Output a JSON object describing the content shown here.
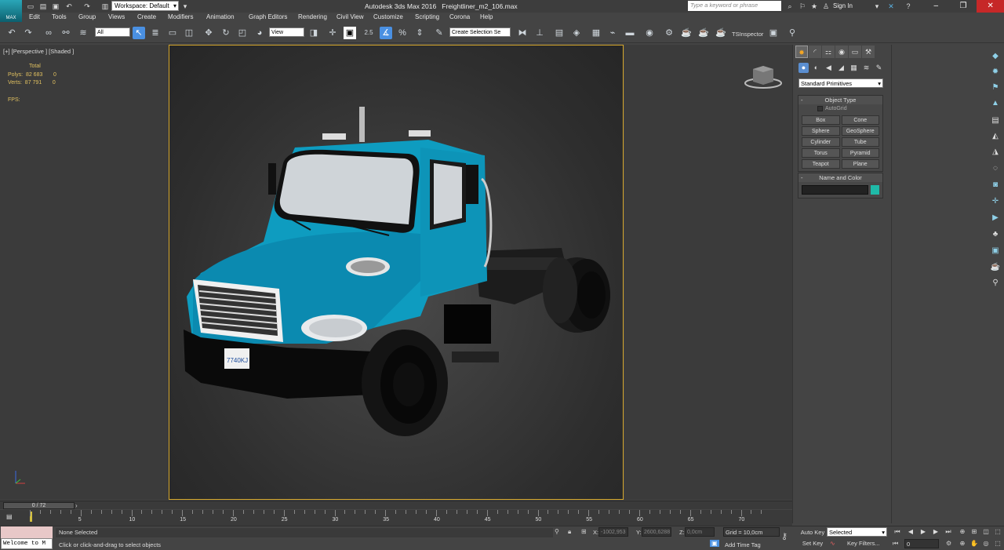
{
  "app": {
    "window_title": "Autodesk 3ds Max 2016",
    "file_name": "Freightliner_m2_106.max",
    "logo_text": "MAX",
    "workspace_label": "Workspace: Default",
    "search_placeholder": "Type a keyword or phrase",
    "sign_in": "Sign In"
  },
  "menu": [
    "Edit",
    "Tools",
    "Group",
    "Views",
    "Create",
    "Modifiers",
    "Animation",
    "Graph Editors",
    "Rendering",
    "Civil View",
    "Customize",
    "Scripting",
    "Corona",
    "Help"
  ],
  "toolbar": {
    "filter_value": "All",
    "ref_coord_value": "View",
    "selection_set_placeholder": "Create Selection Se",
    "snap_label": "2.5",
    "tsinspector": "TSInspector"
  },
  "viewport": {
    "label": "[+] [Perspective ] [Shaded ]",
    "stats": {
      "header": "Total",
      "polys_label": "Polys:",
      "polys_total": "82 683",
      "polys_sel": "0",
      "verts_label": "Verts:",
      "verts_total": "87 791",
      "verts_sel": "0",
      "fps_label": "FPS:"
    },
    "license_plate": "7740KJ"
  },
  "command_panel": {
    "dropdown": "Standard Primitives",
    "object_type_title": "Object Type",
    "autogrid": "AutoGrid",
    "buttons": [
      "Box",
      "Cone",
      "Sphere",
      "GeoSphere",
      "Cylinder",
      "Tube",
      "Torus",
      "Pyramid",
      "Teapot",
      "Plane"
    ],
    "name_color_title": "Name and Color",
    "object_color": "#1fbaa8"
  },
  "timeline": {
    "frame_counter": "0 / 72",
    "ticks": [
      "5",
      "10",
      "15",
      "20",
      "25",
      "30",
      "35",
      "40",
      "45",
      "50",
      "55",
      "60",
      "65",
      "70"
    ]
  },
  "status": {
    "maxscript_output": "Welcome to M",
    "selection": "None Selected",
    "prompt": "Click or click-and-drag to select objects",
    "x_label": "X:",
    "x_value": "-1002,953",
    "y_label": "Y:",
    "y_value": "2600,6288",
    "z_label": "Z:",
    "z_value": "0,0cm",
    "grid": "Grid = 10,0cm",
    "add_time_tag": "Add Time Tag",
    "auto_key": "Auto Key",
    "set_key": "Set Key",
    "key_mode": "Selected",
    "key_filters": "Key Filters...",
    "current_frame": "0"
  },
  "colors": {
    "viewport_border": "#d4a62a",
    "truck_cab": "#0e9cc0",
    "stats_text": "#e0c060",
    "close_button": "#c62828"
  }
}
